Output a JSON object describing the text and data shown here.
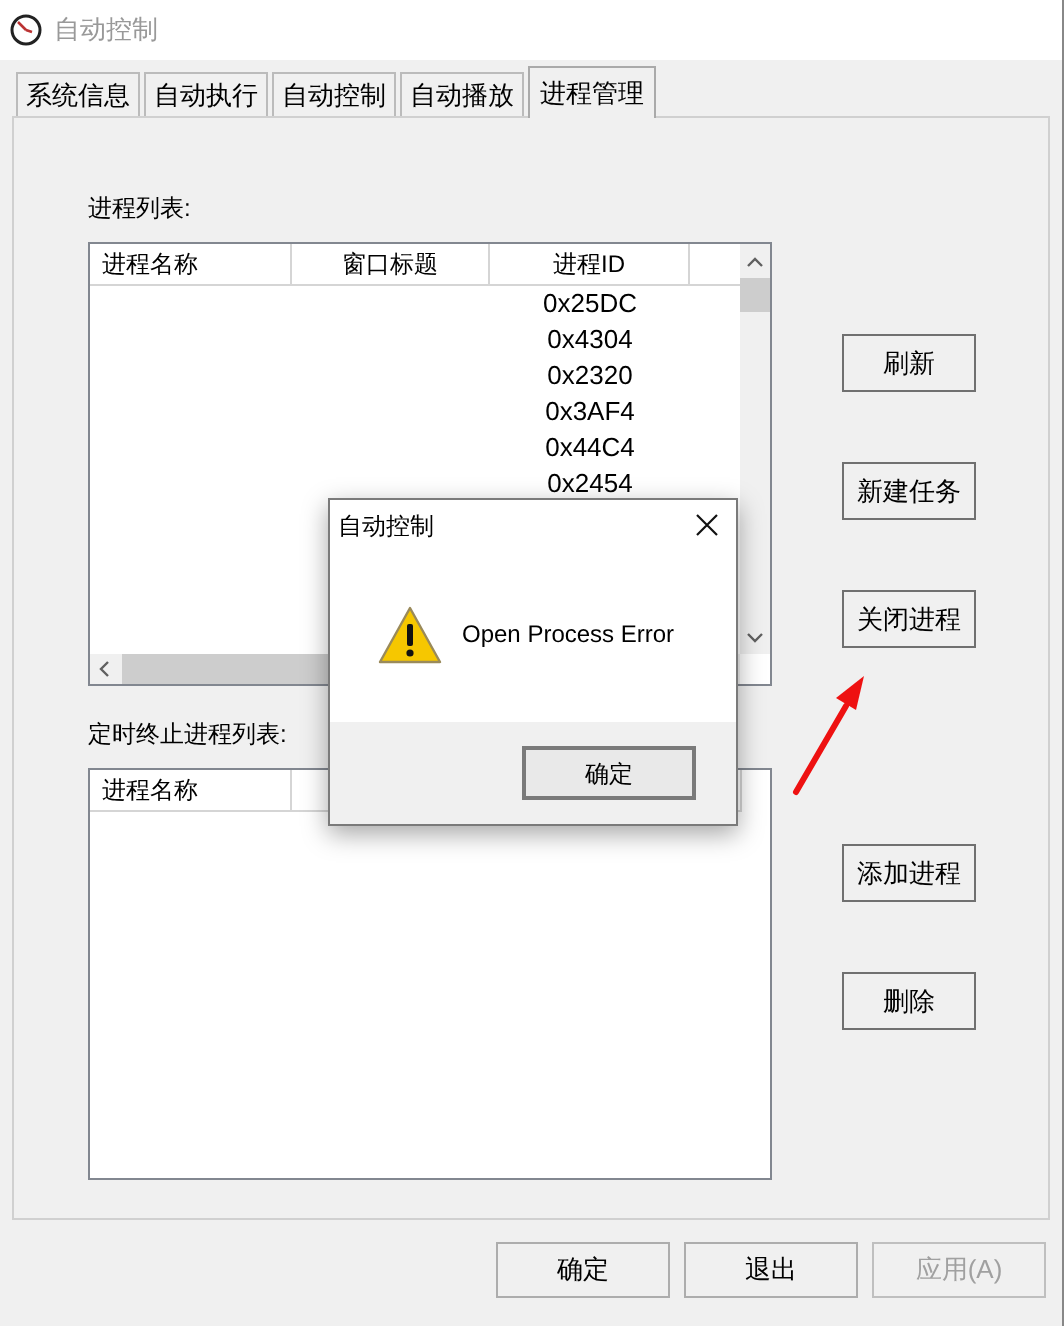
{
  "window": {
    "title": "自动控制"
  },
  "tabs": [
    {
      "label": "系统信息",
      "selected": false
    },
    {
      "label": "自动执行",
      "selected": false
    },
    {
      "label": "自动控制",
      "selected": false
    },
    {
      "label": "自动播放",
      "selected": false
    },
    {
      "label": "进程管理",
      "selected": true
    }
  ],
  "process_list": {
    "label": "进程列表:",
    "columns": [
      "进程名称",
      "窗口标题",
      "进程ID"
    ],
    "rows": [
      {
        "process_id": "0x25DC"
      },
      {
        "process_id": "0x4304"
      },
      {
        "process_id": "0x2320"
      },
      {
        "process_id": "0x3AF4"
      },
      {
        "process_id": "0x44C4"
      },
      {
        "process_id": "0x2454"
      }
    ]
  },
  "timed_list": {
    "label": "定时终止进程列表:",
    "columns": [
      "进程名称"
    ]
  },
  "side_buttons": [
    "刷新",
    "新建任务",
    "关闭进程",
    "添加进程",
    "删除"
  ],
  "bottom_buttons": [
    {
      "label": "确定",
      "disabled": false
    },
    {
      "label": "退出",
      "disabled": false
    },
    {
      "label": "应用(A)",
      "disabled": true
    }
  ],
  "dialog": {
    "title": "自动控制",
    "message": "Open Process Error",
    "button": "确定"
  }
}
